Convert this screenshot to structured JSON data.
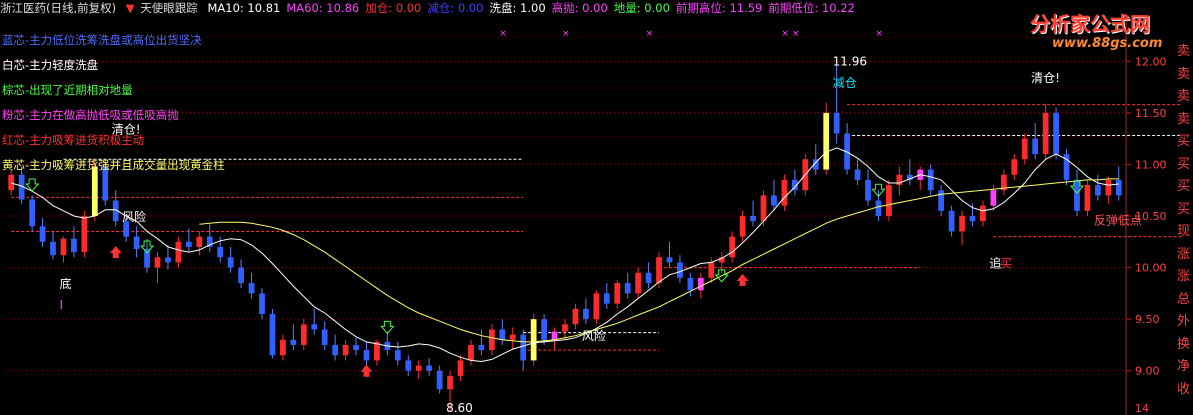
{
  "header": {
    "stock_name": "浙江医药(日线,前复权)",
    "indicator_marker": "▼",
    "indicator_name": "天使眼跟踪",
    "items": [
      {
        "label": "MA10:",
        "value": "10.81",
        "color": "#ffffff"
      },
      {
        "label": "MA60:",
        "value": "10.86",
        "color": "#ff40ff"
      },
      {
        "label": "加仓:",
        "value": "0.00",
        "color": "#ff3030"
      },
      {
        "label": "减仓:",
        "value": "0.00",
        "color": "#4040ff"
      },
      {
        "label": "洗盘:",
        "value": "1.00",
        "color": "#ffffff"
      },
      {
        "label": "高抛:",
        "value": "0.00",
        "color": "#ff40ff"
      },
      {
        "label": "地量:",
        "value": "0.00",
        "color": "#40ff40"
      },
      {
        "label": "前期高位:",
        "value": "11.59",
        "color": "#ff40ff"
      },
      {
        "label": "前期低位:",
        "value": "10.22",
        "color": "#ff40ff"
      }
    ]
  },
  "legend_lines": [
    {
      "text": "蓝芯-主力低位洗筹洗盘或高位出货坚决",
      "color": "#4a6cff"
    },
    {
      "text": "白芯-主力轻度洗盘",
      "color": "#ffffff"
    },
    {
      "text": "棕芯-出现了近期相对地量",
      "color": "#40ff40"
    },
    {
      "text": "粉芯-主力在做高抛低吸或低吸高抛",
      "color": "#ff40ff"
    },
    {
      "text": "红芯-主力吸筹进货积极主动",
      "color": "#ff3030"
    },
    {
      "text": "黄芯-主力吸筹进货强并且成交量出现黄金柱",
      "color": "#ffff66"
    }
  ],
  "right_column": {
    "chars": [
      "卖",
      "卖",
      "卖",
      "卖",
      "买",
      "买",
      "买",
      "买",
      "现",
      "涨",
      "涨",
      "总",
      "外",
      "换",
      "净",
      "收"
    ],
    "color": "#ff4040"
  },
  "watermark": {
    "title": "分析家公式网",
    "url": "www.88gs.com"
  },
  "chart_data": {
    "type": "candlestick",
    "ylim": [
      8.6,
      12.4
    ],
    "yticks": [
      "12.00",
      "11.50",
      "11.00",
      "10.50",
      "10.00",
      "9.50",
      "9.00"
    ],
    "ytick_values": [
      12.0,
      11.5,
      11.0,
      10.5,
      10.0,
      9.5,
      9.0
    ],
    "bottom_tick_label": "14",
    "series": [
      {
        "name": "MA10",
        "color": "#ffffff",
        "values": [
          10.82,
          10.79,
          10.74,
          10.68,
          10.6,
          10.55,
          10.5,
          10.48,
          10.5,
          10.56,
          10.56,
          10.5,
          10.45,
          10.35,
          10.28,
          10.2,
          10.17,
          10.15,
          10.17,
          10.22,
          10.26,
          10.28,
          10.27,
          10.22,
          10.14,
          10.04,
          9.93,
          9.82,
          9.72,
          9.62,
          9.56,
          9.48,
          9.4,
          9.33,
          9.28,
          9.26,
          9.24,
          9.23,
          9.24,
          9.26,
          9.25,
          9.22,
          9.17,
          9.13,
          9.1,
          9.09,
          9.11,
          9.16,
          9.21,
          9.24,
          9.27,
          9.28,
          9.29,
          9.3,
          9.32,
          9.36,
          9.41,
          9.47,
          9.55,
          9.62,
          9.7,
          9.78,
          9.86,
          9.93,
          9.96,
          10.0,
          10.04,
          10.05,
          10.09,
          10.15,
          10.24,
          10.34,
          10.45,
          10.56,
          10.68,
          10.78,
          10.9,
          11.02,
          11.12,
          11.16,
          11.12,
          11.06,
          10.98,
          10.88,
          10.82,
          10.82,
          10.86,
          10.9,
          10.88,
          10.85,
          10.75,
          10.65,
          10.58,
          10.55,
          10.57,
          10.63,
          10.72,
          10.82,
          10.95,
          11.05,
          11.1,
          11.05,
          10.97,
          10.88,
          10.82,
          10.8,
          10.81
        ]
      },
      {
        "name": "MA60",
        "color": "#ffff66",
        "values": [
          null,
          null,
          null,
          null,
          null,
          null,
          null,
          null,
          null,
          null,
          null,
          null,
          null,
          null,
          null,
          null,
          null,
          null,
          10.42,
          10.43,
          10.44,
          10.44,
          10.44,
          10.43,
          10.41,
          10.39,
          10.36,
          10.32,
          10.27,
          10.21,
          10.15,
          10.08,
          10.01,
          9.94,
          9.87,
          9.8,
          9.73,
          9.67,
          9.61,
          9.56,
          9.52,
          9.48,
          9.44,
          9.4,
          9.37,
          9.34,
          9.32,
          9.3,
          9.29,
          9.28,
          9.28,
          9.29,
          9.3,
          9.32,
          9.34,
          9.37,
          9.4,
          9.43,
          9.46,
          9.5,
          9.54,
          9.58,
          9.62,
          9.67,
          9.72,
          9.77,
          9.82,
          9.87,
          9.92,
          9.97,
          10.03,
          10.08,
          10.13,
          10.18,
          10.23,
          10.28,
          10.33,
          10.38,
          10.43,
          10.47,
          10.5,
          10.53,
          10.56,
          10.59,
          10.61,
          10.63,
          10.65,
          10.67,
          10.69,
          10.71,
          10.72,
          10.73,
          10.74,
          10.75,
          10.76,
          10.77,
          10.78,
          10.79,
          10.8,
          10.81,
          10.82,
          10.83,
          10.84,
          10.85,
          10.85,
          10.86,
          10.86
        ]
      }
    ],
    "candles": [
      [
        10.75,
        10.95,
        10.7,
        10.9
      ],
      [
        10.9,
        10.98,
        10.62,
        10.66
      ],
      [
        10.66,
        10.7,
        10.35,
        10.4
      ],
      [
        10.4,
        10.48,
        10.2,
        10.25
      ],
      [
        10.25,
        10.35,
        10.08,
        10.12
      ],
      [
        10.12,
        10.3,
        10.05,
        10.28
      ],
      [
        10.28,
        10.4,
        10.1,
        10.15
      ],
      [
        10.15,
        10.55,
        10.1,
        10.5
      ],
      [
        10.5,
        11.05,
        10.45,
        10.98
      ],
      [
        10.98,
        11.05,
        10.6,
        10.65
      ],
      [
        10.65,
        10.75,
        10.4,
        10.45
      ],
      [
        10.45,
        10.5,
        10.25,
        10.3
      ],
      [
        10.3,
        10.4,
        10.1,
        10.18
      ],
      [
        10.18,
        10.28,
        9.95,
        10.0
      ],
      [
        10.0,
        10.15,
        9.85,
        10.1
      ],
      [
        10.1,
        10.22,
        9.98,
        10.05
      ],
      [
        10.05,
        10.3,
        10.0,
        10.25
      ],
      [
        10.25,
        10.38,
        10.15,
        10.2
      ],
      [
        10.2,
        10.35,
        10.12,
        10.3
      ],
      [
        10.3,
        10.42,
        10.15,
        10.2
      ],
      [
        10.2,
        10.3,
        10.05,
        10.1
      ],
      [
        10.1,
        10.2,
        9.95,
        10.0
      ],
      [
        10.0,
        10.08,
        9.8,
        9.85
      ],
      [
        9.85,
        9.95,
        9.7,
        9.75
      ],
      [
        9.75,
        9.8,
        9.5,
        9.55
      ],
      [
        9.55,
        9.6,
        9.12,
        9.15
      ],
      [
        9.15,
        9.35,
        9.1,
        9.3
      ],
      [
        9.3,
        9.45,
        9.2,
        9.25
      ],
      [
        9.25,
        9.5,
        9.2,
        9.45
      ],
      [
        9.45,
        9.6,
        9.35,
        9.4
      ],
      [
        9.4,
        9.48,
        9.2,
        9.25
      ],
      [
        9.25,
        9.35,
        9.1,
        9.15
      ],
      [
        9.15,
        9.3,
        9.1,
        9.25
      ],
      [
        9.25,
        9.32,
        9.15,
        9.2
      ],
      [
        9.2,
        9.28,
        9.05,
        9.1
      ],
      [
        9.1,
        9.3,
        9.05,
        9.28
      ],
      [
        9.28,
        9.38,
        9.15,
        9.2
      ],
      [
        9.2,
        9.28,
        9.05,
        9.1
      ],
      [
        9.1,
        9.15,
        8.95,
        9.0
      ],
      [
        9.0,
        9.1,
        8.92,
        9.05
      ],
      [
        9.05,
        9.12,
        8.95,
        9.0
      ],
      [
        9.0,
        9.05,
        8.78,
        8.82
      ],
      [
        8.82,
        9.0,
        8.6,
        8.95
      ],
      [
        8.95,
        9.15,
        8.9,
        9.1
      ],
      [
        9.1,
        9.3,
        9.05,
        9.25
      ],
      [
        9.25,
        9.4,
        9.15,
        9.2
      ],
      [
        9.2,
        9.45,
        9.15,
        9.4
      ],
      [
        9.4,
        9.5,
        9.25,
        9.3
      ],
      [
        9.3,
        9.42,
        9.2,
        9.35
      ],
      [
        9.35,
        9.4,
        9.0,
        9.1
      ],
      [
        9.1,
        9.55,
        9.05,
        9.5
      ],
      [
        9.5,
        9.55,
        9.25,
        9.3
      ],
      [
        9.3,
        9.42,
        9.2,
        9.38
      ],
      [
        9.38,
        9.5,
        9.3,
        9.45
      ],
      [
        9.45,
        9.65,
        9.4,
        9.6
      ],
      [
        9.6,
        9.7,
        9.45,
        9.5
      ],
      [
        9.5,
        9.78,
        9.45,
        9.75
      ],
      [
        9.75,
        9.85,
        9.6,
        9.65
      ],
      [
        9.65,
        9.88,
        9.6,
        9.85
      ],
      [
        9.85,
        9.95,
        9.7,
        9.75
      ],
      [
        9.75,
        10.0,
        9.7,
        9.95
      ],
      [
        9.95,
        10.05,
        9.8,
        9.85
      ],
      [
        9.85,
        10.15,
        9.8,
        10.1
      ],
      [
        10.1,
        10.25,
        10.0,
        10.05
      ],
      [
        10.05,
        10.12,
        9.85,
        9.9
      ],
      [
        9.9,
        9.95,
        9.72,
        9.78
      ],
      [
        9.78,
        9.95,
        9.7,
        9.9
      ],
      [
        9.9,
        10.1,
        9.85,
        10.05
      ],
      [
        10.05,
        10.15,
        9.95,
        10.1
      ],
      [
        10.1,
        10.35,
        10.05,
        10.3
      ],
      [
        10.3,
        10.55,
        10.25,
        10.5
      ],
      [
        10.5,
        10.65,
        10.4,
        10.45
      ],
      [
        10.45,
        10.75,
        10.4,
        10.7
      ],
      [
        10.7,
        10.85,
        10.55,
        10.6
      ],
      [
        10.6,
        10.9,
        10.55,
        10.85
      ],
      [
        10.85,
        10.95,
        10.7,
        10.75
      ],
      [
        10.75,
        11.1,
        10.7,
        11.05
      ],
      [
        11.05,
        11.2,
        10.9,
        10.95
      ],
      [
        10.95,
        11.6,
        10.9,
        11.5
      ],
      [
        11.5,
        11.96,
        11.2,
        11.3
      ],
      [
        11.3,
        11.4,
        10.9,
        10.95
      ],
      [
        10.95,
        11.05,
        10.8,
        10.85
      ],
      [
        10.85,
        10.95,
        10.6,
        10.65
      ],
      [
        10.65,
        10.75,
        10.45,
        10.5
      ],
      [
        10.5,
        10.85,
        10.45,
        10.8
      ],
      [
        10.8,
        10.98,
        10.7,
        10.9
      ],
      [
        10.9,
        11.05,
        10.8,
        10.85
      ],
      [
        10.85,
        10.98,
        10.75,
        10.95
      ],
      [
        10.95,
        11.0,
        10.7,
        10.75
      ],
      [
        10.75,
        10.8,
        10.5,
        10.55
      ],
      [
        10.55,
        10.6,
        10.3,
        10.35
      ],
      [
        10.35,
        10.55,
        10.22,
        10.5
      ],
      [
        10.5,
        10.62,
        10.4,
        10.45
      ],
      [
        10.45,
        10.65,
        10.4,
        10.6
      ],
      [
        10.6,
        10.8,
        10.55,
        10.75
      ],
      [
        10.75,
        10.95,
        10.7,
        10.9
      ],
      [
        10.9,
        11.1,
        10.85,
        11.05
      ],
      [
        11.05,
        11.3,
        11.0,
        11.25
      ],
      [
        11.25,
        11.4,
        11.05,
        11.1
      ],
      [
        11.1,
        11.59,
        11.05,
        11.5
      ],
      [
        11.5,
        11.55,
        11.05,
        11.1
      ],
      [
        11.1,
        11.15,
        10.8,
        10.85
      ],
      [
        10.85,
        10.95,
        10.5,
        10.55
      ],
      [
        10.55,
        10.85,
        10.5,
        10.8
      ],
      [
        10.8,
        10.9,
        10.65,
        10.7
      ],
      [
        10.7,
        10.88,
        10.62,
        10.85
      ],
      [
        10.85,
        10.98,
        10.65,
        10.7
      ]
    ],
    "annotations": [
      {
        "text": "清仓!",
        "i": 10,
        "price": 11.3,
        "color": "#ffffff"
      },
      {
        "text": "风险",
        "i": 11,
        "price": 10.45,
        "color": "#ffffff"
      },
      {
        "text": "底",
        "i": 5,
        "price": 9.8,
        "color": "#ffffff"
      },
      {
        "text": "I",
        "i": 5,
        "price": 9.6,
        "color": "#ff40ff"
      },
      {
        "text": "8.60",
        "i": 42,
        "price": 8.6,
        "color": "#ffffff"
      },
      {
        "text": "风险",
        "i": 55,
        "price": 9.3,
        "color": "#ffffff"
      },
      {
        "text": "11.96",
        "i": 79,
        "price": 11.96,
        "color": "#ffffff"
      },
      {
        "text": "减仓",
        "i": 79,
        "price": 11.75,
        "color": "#00e5ff"
      },
      {
        "text": "清仓!",
        "i": 98,
        "price": 11.8,
        "color": "#ffffff"
      },
      {
        "text": "追",
        "i": 94,
        "price": 10.0,
        "color": "#ffffff"
      },
      {
        "text": "买",
        "i": 95,
        "price": 10.0,
        "color": "#ff3030"
      },
      {
        "text": "反弹低点",
        "i": 104,
        "price": 10.42,
        "color": "#ff5050"
      }
    ],
    "signals": [
      {
        "type": "down-green",
        "i": 2,
        "price": 10.8
      },
      {
        "type": "down-green",
        "i": 13,
        "price": 10.2
      },
      {
        "type": "up-red",
        "i": 10,
        "price": 10.15
      },
      {
        "type": "down-green",
        "i": 36,
        "price": 9.42
      },
      {
        "type": "up-red",
        "i": 34,
        "price": 9.0
      },
      {
        "type": "down-green",
        "i": 68,
        "price": 9.92
      },
      {
        "type": "up-red",
        "i": 70,
        "price": 9.88
      },
      {
        "type": "down-green",
        "i": 83,
        "price": 10.75
      },
      {
        "type": "down-green",
        "i": 102,
        "price": 10.78
      }
    ],
    "dashed_levels": [
      {
        "price": 11.05,
        "i0": 5,
        "i1": 49,
        "color": "#ffffff"
      },
      {
        "price": 10.68,
        "i0": 0,
        "i1": 49,
        "color": "#ff3030"
      },
      {
        "price": 10.35,
        "i0": 0,
        "i1": 49,
        "color": "#ff3030"
      },
      {
        "price": 9.2,
        "i0": 49,
        "i1": 62,
        "color": "#ff3030"
      },
      {
        "price": 9.37,
        "i0": 49,
        "i1": 62,
        "color": "#ffffff"
      },
      {
        "price": 10.0,
        "i0": 62,
        "i1": 87,
        "color": "#ff3030"
      },
      {
        "price": 11.58,
        "i0": 80,
        "i1": 112,
        "color": "#ff3030"
      },
      {
        "price": 11.28,
        "i0": 80,
        "i1": 112,
        "color": "#ffffff"
      },
      {
        "price": 10.3,
        "i0": 94,
        "i1": 112,
        "color": "#ff3030"
      }
    ],
    "grid_levels": [
      12.0,
      11.5,
      11.0,
      10.5,
      10.0,
      9.5,
      9.0
    ],
    "top_marks": [
      {
        "i": 47
      },
      {
        "i": 53
      },
      {
        "i": 61
      },
      {
        "i": 74
      },
      {
        "i": 75
      },
      {
        "i": 83
      }
    ]
  }
}
